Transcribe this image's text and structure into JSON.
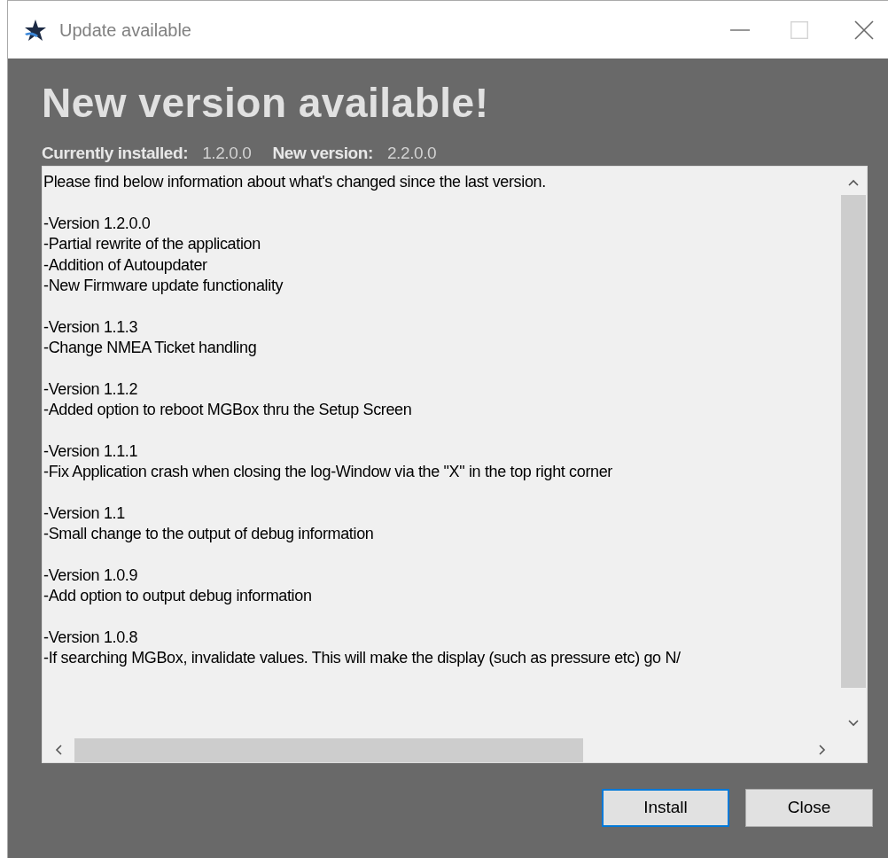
{
  "window": {
    "title": "Update available",
    "controls": [
      {
        "kind": "minimize",
        "disabled": false
      },
      {
        "kind": "maximize",
        "disabled": true
      },
      {
        "kind": "close",
        "disabled": false
      }
    ]
  },
  "heading": "New version available!",
  "versions": [
    {
      "label": "Currently installed:",
      "value": "1.2.0.0"
    },
    {
      "label": "New version:",
      "value": "2.2.0.0"
    }
  ],
  "changelog": [
    [
      "Please find below information about what's changed since the last version."
    ],
    [
      "-Version 1.2.0.0",
      "-Partial rewrite of the application",
      "-Addition of Autoupdater",
      "-New Firmware update functionality"
    ],
    [
      "-Version 1.1.3",
      "-Change NMEA Ticket handling"
    ],
    [
      "-Version 1.1.2",
      "-Added option to reboot MGBox thru the Setup Screen"
    ],
    [
      "-Version 1.1.1",
      "-Fix Application crash when closing the log-Window via the \"X\" in the top right corner"
    ],
    [
      "-Version 1.1",
      "-Small change to the output of debug information"
    ],
    [
      "-Version 1.0.9",
      "-Add option to output debug information"
    ],
    [
      "-Version 1.0.8",
      "-If searching MGBox, invalidate values. This will make the display (such as pressure etc) go N/"
    ]
  ],
  "buttons": [
    {
      "label": "Install",
      "default": true
    },
    {
      "label": "Close",
      "default": false
    }
  ]
}
